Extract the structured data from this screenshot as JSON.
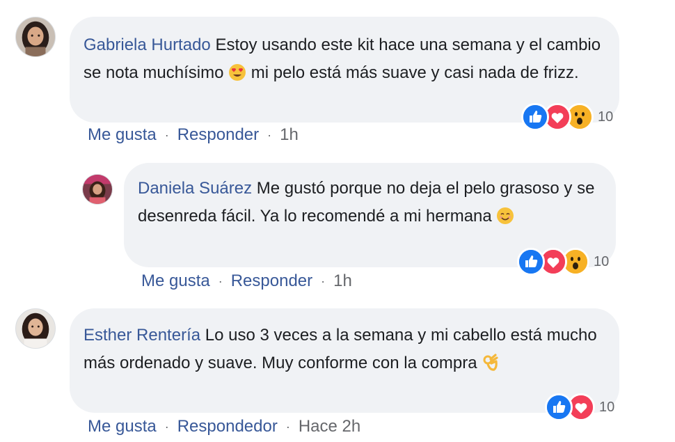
{
  "comments": [
    {
      "author": "Gabriela Hurtado",
      "text_before_emoji": "Estoy usando este kit hace una semana y el cambio se nota muchísimo",
      "emoji": "heart-eyes-emoji",
      "text_after_emoji": "mi pelo está más suave y casi nada de frizz.",
      "reactions": [
        "like",
        "love",
        "wow"
      ],
      "reaction_count": "10",
      "like_label": "Me gusta",
      "reply_label": "Responder",
      "time": "1h"
    },
    {
      "author": "Daniela Suárez",
      "text_before_emoji": "Me gustó porque no deja el pelo grasoso y se desenreda fácil. Ya lo recomendé a mi hermana",
      "emoji": "smiling-emoji",
      "text_after_emoji": "",
      "reactions": [
        "like",
        "love",
        "wow"
      ],
      "reaction_count": "10",
      "like_label": "Me gusta",
      "reply_label": "Responder",
      "time": "1h"
    },
    {
      "author": "Esther Rentería",
      "text_before_emoji": "Lo uso 3 veces a la semana y mi cabello está mucho más ordenado y suave. Muy conforme con la compra",
      "emoji": "ok-hand-emoji",
      "text_after_emoji": "",
      "reactions": [
        "like",
        "love"
      ],
      "reaction_count": "10",
      "like_label": "Me gusta",
      "reply_label": "Respondedor",
      "time": "Hace 2h"
    }
  ],
  "separator": "·",
  "colors": {
    "author": "#385898",
    "bubble": "#f0f2f5",
    "meta": "#65676b",
    "like": "#1877f2",
    "love": "#f33e58",
    "wow": "#f7b125"
  }
}
